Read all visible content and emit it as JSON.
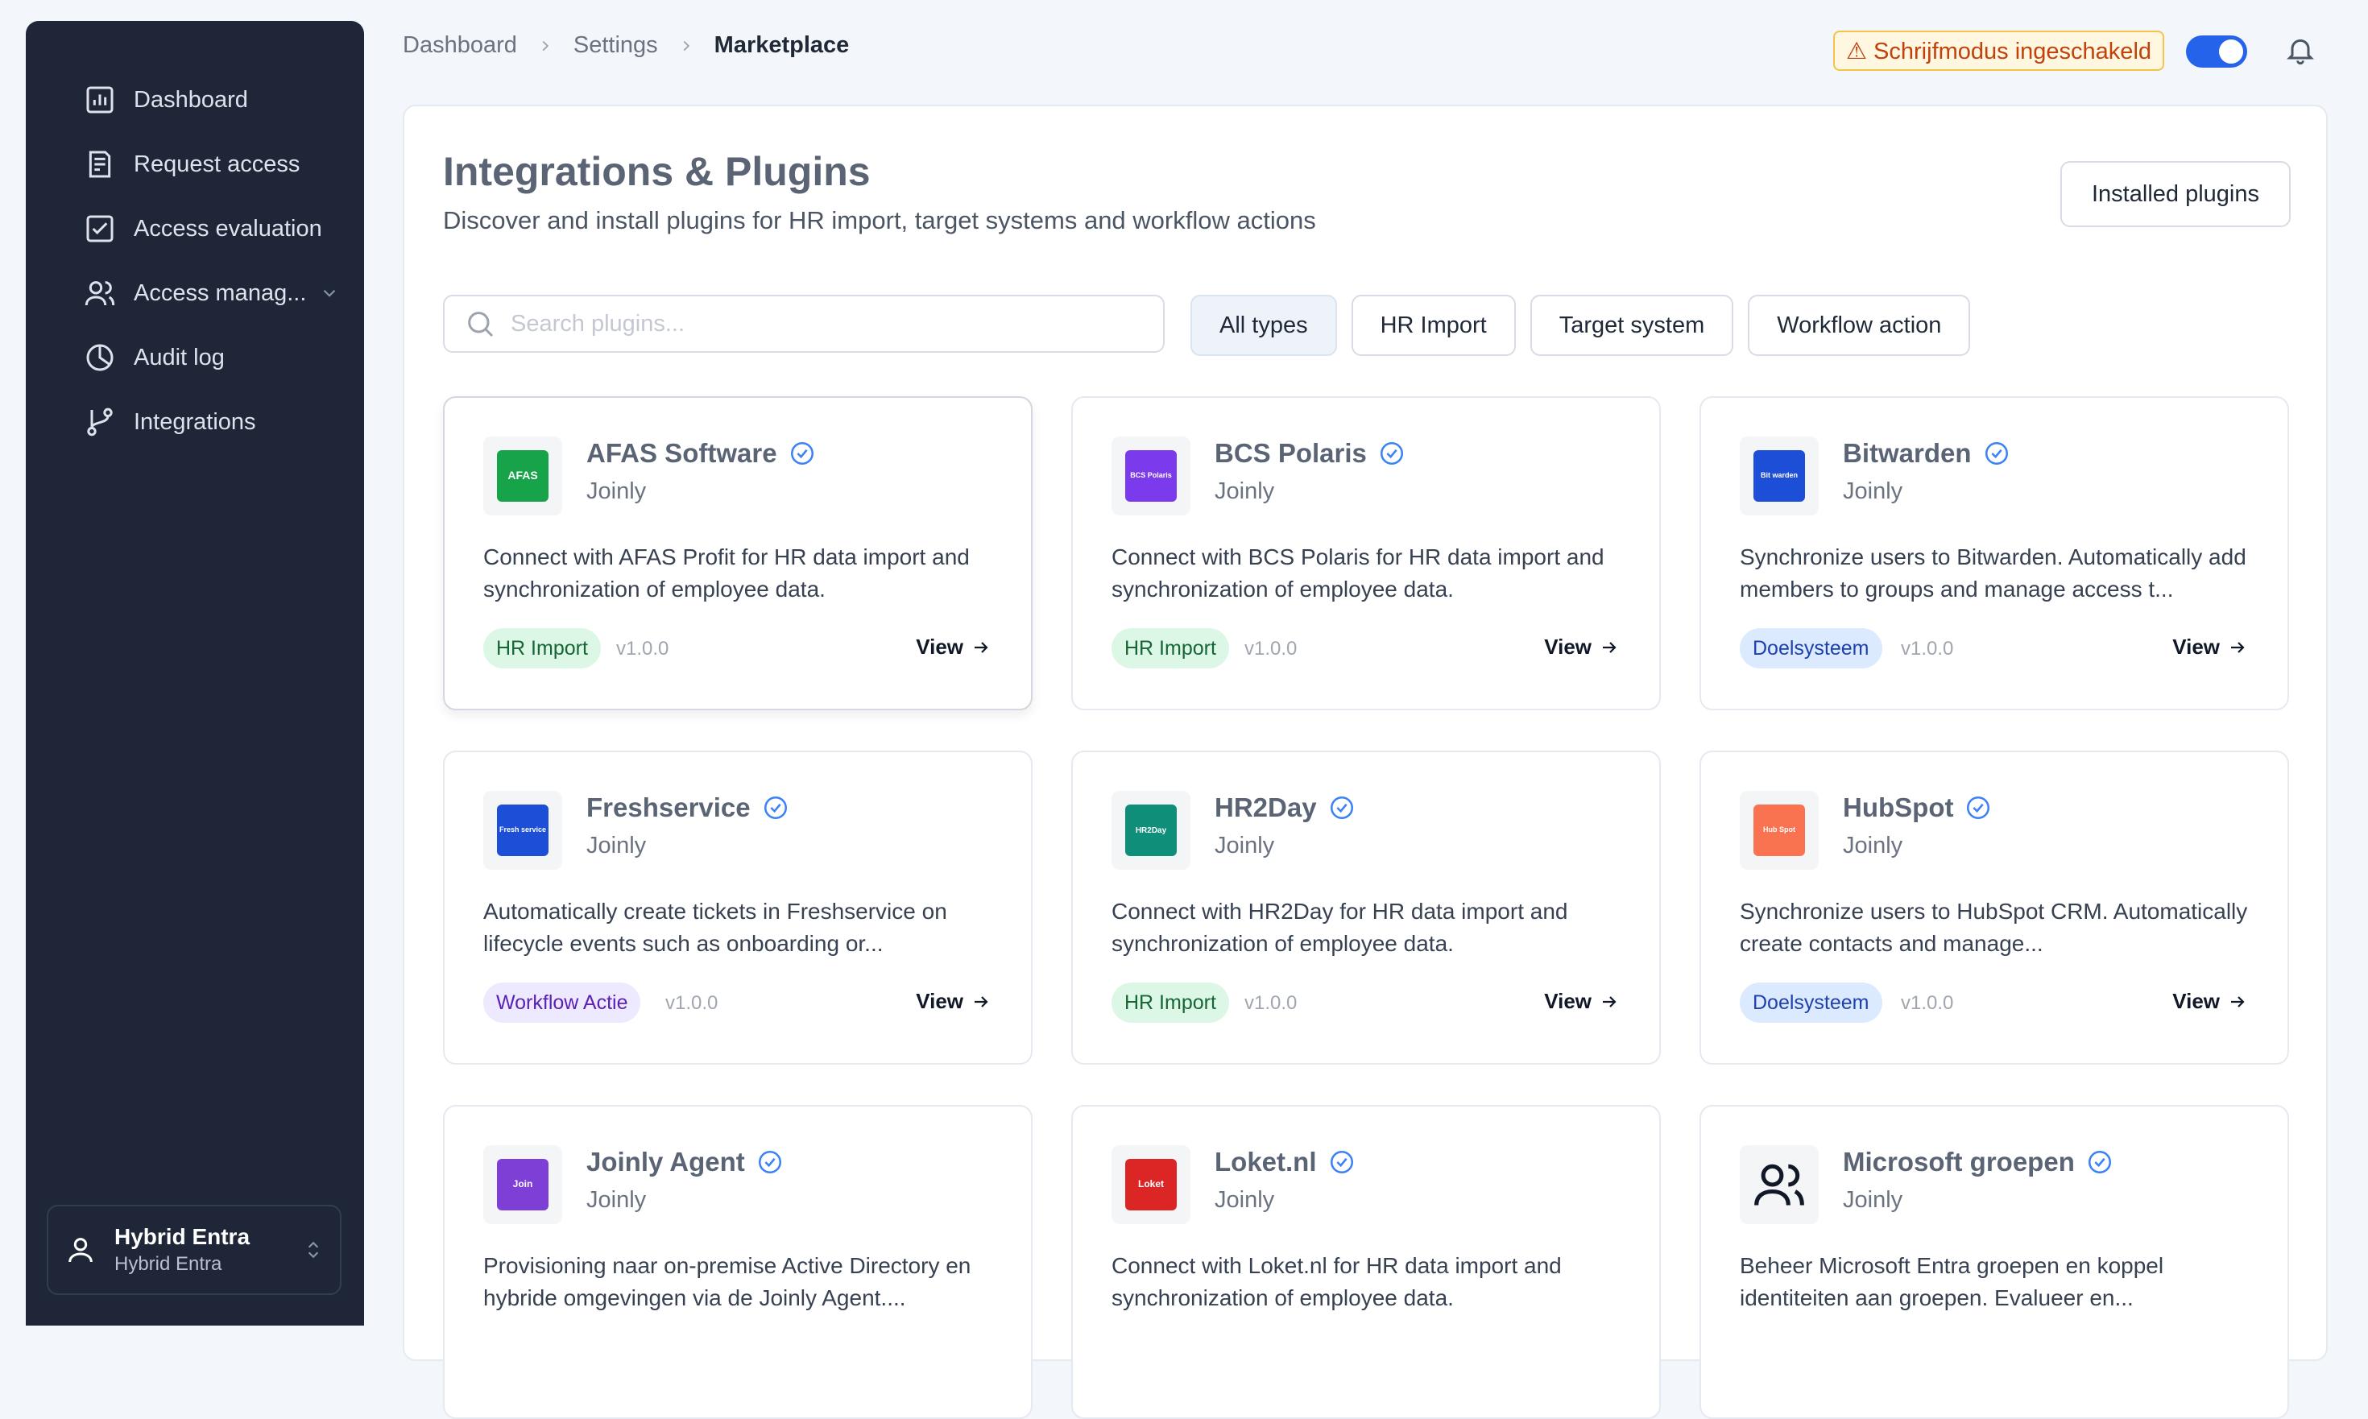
{
  "sidebar": {
    "items": [
      {
        "label": "Dashboard",
        "icon": "bar-chart-icon"
      },
      {
        "label": "Request access",
        "icon": "clipboard-icon"
      },
      {
        "label": "Access evaluation",
        "icon": "check-square-icon"
      },
      {
        "label": "Access manag...",
        "icon": "users-icon"
      },
      {
        "label": "Audit log",
        "icon": "pie-chart-icon"
      },
      {
        "label": "Integrations",
        "icon": "git-branch-icon"
      }
    ],
    "user": {
      "name": "Hybrid Entra",
      "org": "Hybrid Entra"
    }
  },
  "header": {
    "breadcrumb": [
      "Dashboard",
      "Settings",
      "Marketplace"
    ],
    "mode_badge": "⚠ Schrijfmodus ingeschakeld",
    "toggle_on": true
  },
  "main": {
    "title": "Integrations & Plugins",
    "subtitle": "Discover and install plugins for HR import, target systems and workflow actions",
    "installed_button": "Installed plugins",
    "search_placeholder": "Search plugins...",
    "filters": [
      "All types",
      "HR Import",
      "Target system",
      "Workflow action"
    ],
    "active_filter": "All types",
    "view_label": "View"
  },
  "plugins": [
    {
      "name": "AFAS Software",
      "vendor": "Joinly",
      "desc": "Connect with AFAS Profit for HR data import and synchronization of employee data.",
      "badge": "HR Import",
      "version": "v1.0.0",
      "logo_text": "AFAS",
      "logo_color": "#16a34a"
    },
    {
      "name": "BCS Polaris",
      "vendor": "Joinly",
      "desc": "Connect with BCS Polaris for HR data import and synchronization of employee data.",
      "badge": "HR Import",
      "version": "v1.0.0",
      "logo_text": "BCS Polaris",
      "logo_color": "#7c3aed"
    },
    {
      "name": "Bitwarden",
      "vendor": "Joinly",
      "desc": "Synchronize users to Bitwarden. Automatically add members to groups and manage access t...",
      "badge": "Doelsysteem",
      "version": "v1.0.0",
      "logo_text": "Bit warden",
      "logo_color": "#1d4ed8"
    },
    {
      "name": "Freshservice",
      "vendor": "Joinly",
      "desc": "Automatically create tickets in Freshservice on lifecycle events such as onboarding or...",
      "badge": "Workflow Actie",
      "version": "v1.0.0",
      "logo_text": "Fresh service",
      "logo_color": "#1d4ed8"
    },
    {
      "name": "HR2Day",
      "vendor": "Joinly",
      "desc": "Connect with HR2Day for HR data import and synchronization of employee data.",
      "badge": "HR Import",
      "version": "v1.0.0",
      "logo_text": "HR2Day",
      "logo_color": "#0f8f7a"
    },
    {
      "name": "HubSpot",
      "vendor": "Joinly",
      "desc": "Synchronize users to HubSpot CRM. Automatically create contacts and manage...",
      "badge": "Doelsysteem",
      "version": "v1.0.0",
      "logo_text": "Hub Spot",
      "logo_color": "#f97350"
    },
    {
      "name": "Joinly Agent",
      "vendor": "Joinly",
      "desc": "Provisioning naar on-premise Active Directory en hybride omgevingen via de Joinly Agent....",
      "badge": "",
      "version": "",
      "logo_text": "Join",
      "logo_color": "#7e3fd6"
    },
    {
      "name": "Loket.nl",
      "vendor": "Joinly",
      "desc": "Connect with Loket.nl for HR data import and synchronization of employee data.",
      "badge": "",
      "version": "",
      "logo_text": "Loket",
      "logo_color": "#dc2626"
    },
    {
      "name": "Microsoft groepen",
      "vendor": "Joinly",
      "desc": "Beheer Microsoft Entra groepen en koppel identiteiten aan groepen. Evalueer en...",
      "badge": "",
      "version": "",
      "logo_text": "",
      "logo_color": "#f4f5f7"
    }
  ]
}
